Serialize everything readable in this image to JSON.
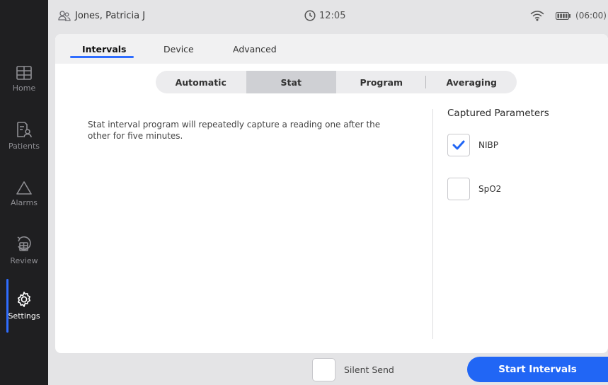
{
  "sidebar": {
    "items": [
      {
        "label": "Home",
        "icon": "home-grid-icon"
      },
      {
        "label": "Patients",
        "icon": "patients-icon"
      },
      {
        "label": "Alarms",
        "icon": "alarm-triangle-icon"
      },
      {
        "label": "Review",
        "icon": "review-icon"
      },
      {
        "label": "Settings",
        "icon": "gear-icon"
      }
    ],
    "active": "Settings",
    "accent_color": "#2f6dff"
  },
  "status": {
    "patient_name": "Jones, Patricia J",
    "time": "12:05",
    "battery_time": "(06:00)"
  },
  "tabs": [
    {
      "label": "Intervals"
    },
    {
      "label": "Device"
    },
    {
      "label": "Advanced"
    }
  ],
  "active_tab": "Intervals",
  "interval_modes": [
    {
      "label": "Automatic"
    },
    {
      "label": "Stat"
    },
    {
      "label": "Program"
    },
    {
      "label": "Averaging"
    }
  ],
  "active_mode": "Stat",
  "description": "Stat interval program will repeatedly capture a reading one after the other for five minutes.",
  "captured": {
    "title": "Captured Parameters",
    "params": [
      {
        "label": "NIBP",
        "checked": true
      },
      {
        "label": "SpO2",
        "checked": false
      }
    ]
  },
  "footer": {
    "silent_send_label": "Silent Send",
    "silent_send_checked": false,
    "start_button_label": "Start Intervals",
    "primary_color": "#2166f5"
  }
}
